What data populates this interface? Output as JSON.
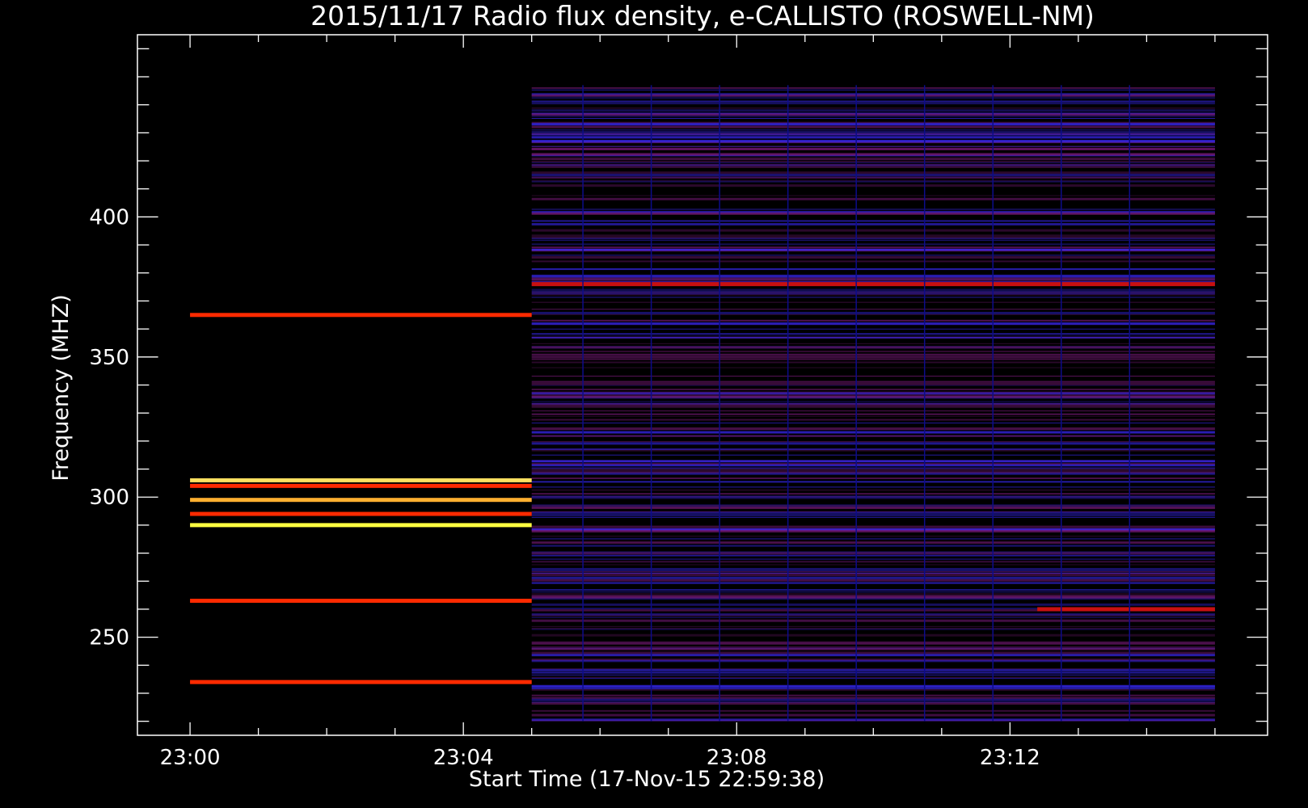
{
  "chart_data": {
    "type": "heatmap",
    "title": "2015/11/17  Radio flux density, e-CALLISTO (ROSWELL-NM)",
    "xlabel": "Start Time (17-Nov-15 22:59:38)",
    "ylabel": "Frequency (MHZ)",
    "x_ticks": [
      "23:00",
      "23:04",
      "23:08",
      "23:12"
    ],
    "x_tick_minutes": [
      0,
      4,
      8,
      12
    ],
    "y_ticks": [
      250,
      300,
      350,
      400
    ],
    "xlim_minutes": [
      -0.77,
      15.77
    ],
    "ylim_mhz": [
      465,
      215
    ],
    "data_extent": {
      "t_start_min": 0.0,
      "t_end_min": 15.0,
      "f_low_mhz": 220,
      "f_high_mhz": 447
    },
    "regime_change_min": 5.0,
    "bright_bands_mhz": [
      {
        "f": 234,
        "c": "#ff2a00",
        "t0": 0,
        "t1": 5
      },
      {
        "f": 263,
        "c": "#ff2a00",
        "t0": 0,
        "t1": 5
      },
      {
        "f": 290,
        "c": "#ffff40",
        "t0": 0,
        "t1": 5
      },
      {
        "f": 294,
        "c": "#ff2a00",
        "t0": 0,
        "t1": 5
      },
      {
        "f": 299,
        "c": "#ffb030",
        "t0": 0,
        "t1": 5
      },
      {
        "f": 304,
        "c": "#ff2a00",
        "t0": 0,
        "t1": 5
      },
      {
        "f": 306,
        "c": "#ffe060",
        "t0": 0,
        "t1": 5
      },
      {
        "f": 365,
        "c": "#ff2a00",
        "t0": 0,
        "t1": 5
      },
      {
        "f": 260,
        "c": "#c81010",
        "t0": 12.4,
        "t1": 15
      },
      {
        "f": 376,
        "c": "#c81010",
        "t0": 5,
        "t1": 15
      }
    ],
    "colors": {
      "background": "#000000",
      "low": "#000000",
      "mid": "#1c1cff",
      "base_high": "#5a1ad0",
      "red": "#ff2a00",
      "yellow": "#ffff40"
    }
  }
}
